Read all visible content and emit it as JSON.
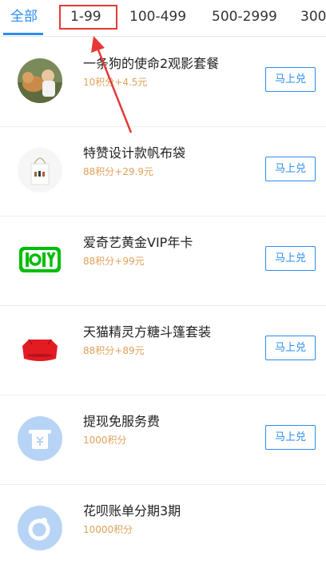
{
  "tabs": [
    {
      "label": "全部",
      "active": true
    },
    {
      "label": "1-99",
      "active": false
    },
    {
      "label": "100-499",
      "active": false
    },
    {
      "label": "500-2999",
      "active": false
    },
    {
      "label": "300",
      "active": false
    }
  ],
  "items": [
    {
      "title": "一条狗的使命2观影套餐",
      "price": "10积分+4.5元",
      "button": "马上兑",
      "icon": "movie-poster-icon"
    },
    {
      "title": "特赞设计款帆布袋",
      "price": "88积分+29.9元",
      "button": "马上兑",
      "icon": "tote-bag-icon"
    },
    {
      "title": "爱奇艺黄金VIP年卡",
      "price": "88积分+99元",
      "button": "马上兑",
      "icon": "iqiyi-logo-icon"
    },
    {
      "title": "天猫精灵方糖斗篷套装",
      "price": "88积分+89元",
      "button": "马上兑",
      "icon": "tmall-genie-icon"
    },
    {
      "title": "提现免服务费",
      "price": "1000积分",
      "button": "马上兑",
      "icon": "withdraw-icon"
    },
    {
      "title": "花呗账单分期3期",
      "price": "10000积分",
      "button": "",
      "icon": "huabei-icon"
    }
  ],
  "colors": {
    "accent": "#2d8cf0",
    "price": "#e0a15a",
    "annotation": "#e53935"
  }
}
